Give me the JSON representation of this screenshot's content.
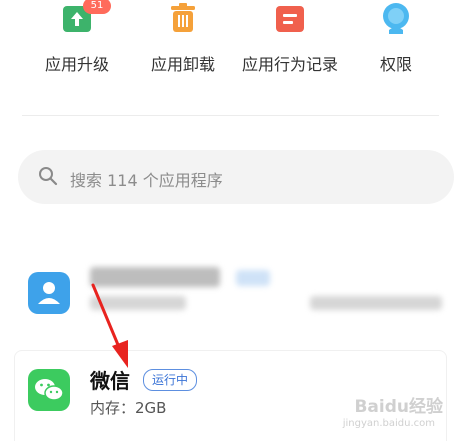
{
  "top_actions": [
    {
      "label": "应用升级",
      "icon": "upgrade-icon",
      "badge": "51",
      "color": "#3db36b"
    },
    {
      "label": "应用卸载",
      "icon": "trash-icon",
      "color": "#f5a13a"
    },
    {
      "label": "应用行为记录",
      "icon": "record-icon",
      "color": "#f0604d"
    },
    {
      "label": "权限",
      "icon": "permission-icon",
      "color": "#4cb8f0"
    }
  ],
  "search": {
    "placeholder": "搜索 114 个应用程序"
  },
  "apps": [
    {
      "name": "微信",
      "status": "运行中",
      "memory": "内存：2GB",
      "icon": "wechat-icon",
      "color": "#3ccb5f"
    }
  ],
  "watermark": {
    "text": "Baidu经验",
    "sub": "jingyan.baidu.com"
  }
}
